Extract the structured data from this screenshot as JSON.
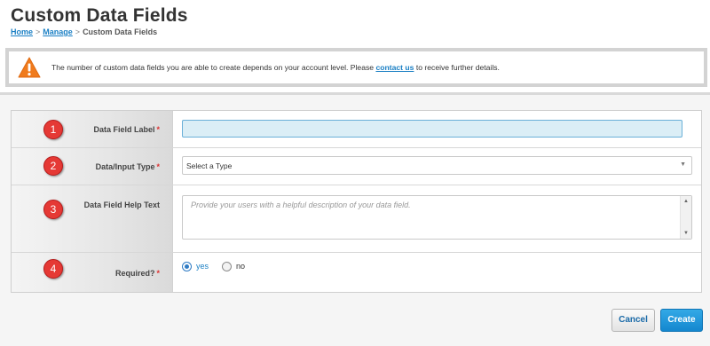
{
  "page": {
    "title": "Custom Data Fields",
    "breadcrumb": {
      "home": "Home",
      "manage": "Manage",
      "current": "Custom Data Fields",
      "separator": ">"
    }
  },
  "alert": {
    "icon": "warning-icon",
    "text_before": "The number of custom data fields you are able to create depends on your account level. Please ",
    "link": "contact us",
    "text_after": " to receive further details."
  },
  "form": {
    "rows": [
      {
        "number": "1",
        "label": "Data Field Label",
        "required_mark": "*"
      },
      {
        "number": "2",
        "label": "Data/Input Type",
        "required_mark": "*"
      },
      {
        "number": "3",
        "label": "Data Field Help Text"
      },
      {
        "number": "4",
        "label": "Required?",
        "required_mark": "*"
      }
    ],
    "data_field_label_value": "",
    "type_select": {
      "selected": "Select a Type"
    },
    "help_text_placeholder": "Provide your users with a helpful description of your data field.",
    "required_options": [
      {
        "label": "yes",
        "checked": true
      },
      {
        "label": "no",
        "checked": false
      }
    ]
  },
  "actions": {
    "cancel": "Cancel",
    "create": "Create"
  },
  "colors": {
    "accent": "#1a7fc4",
    "warning": "#f07b1d",
    "marker": "#e53935",
    "required": "#dd3333"
  }
}
